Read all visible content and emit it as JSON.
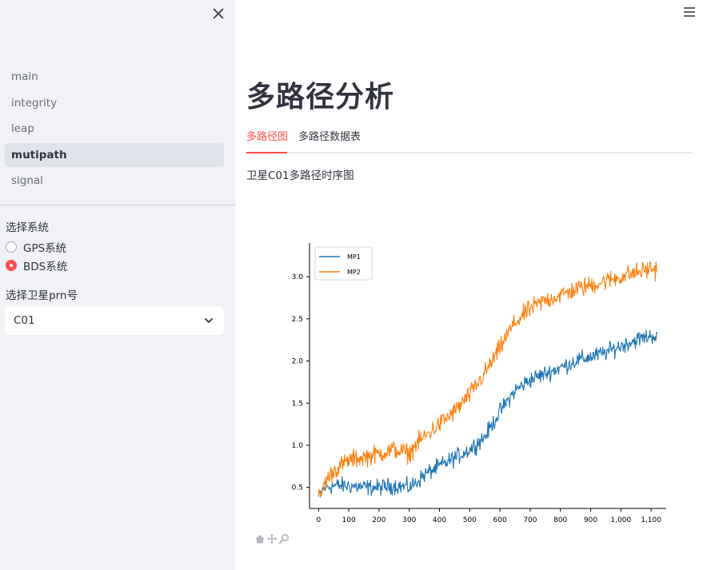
{
  "sidebar": {
    "close_label": "×",
    "nav": [
      "main",
      "integrity",
      "leap",
      "mutipath",
      "signal"
    ],
    "active_nav": "mutipath",
    "system_label": "选择系统",
    "system_options": [
      "GPS系统",
      "BDS系统"
    ],
    "system_selected": "BDS系统",
    "prn_label": "选择卫星prn号",
    "prn_value": "C01"
  },
  "main": {
    "title": "多路径分析",
    "tabs": [
      "多路径图",
      "多路径数据表"
    ],
    "active_tab": "多路径图",
    "caption": "卫星C01多路径时序图"
  },
  "toolbar": [
    "home-icon",
    "pan-icon",
    "zoom-icon"
  ],
  "colors": {
    "accent": "#ff4b4b",
    "mp1": "#1f77b4",
    "mp2": "#ff7f0e"
  },
  "chart_data": {
    "type": "line",
    "title": "",
    "xlabel": "",
    "ylabel": "",
    "xlim": [
      -30,
      1150
    ],
    "ylim": [
      0.25,
      3.4
    ],
    "xticks": [
      0,
      100,
      200,
      300,
      400,
      500,
      600,
      700,
      800,
      900,
      1000,
      1100
    ],
    "xtick_labels": [
      "0",
      "100",
      "200",
      "300",
      "400",
      "500",
      "600",
      "700",
      "800",
      "900",
      "1,000",
      "1,100"
    ],
    "yticks": [
      0.5,
      1.0,
      1.5,
      2.0,
      2.5,
      3.0
    ],
    "ytick_labels": [
      "0.5",
      "1.0",
      "1.5",
      "2.0",
      "2.5",
      "3.0"
    ],
    "legend_position": "top-left",
    "series": [
      {
        "name": "MP1",
        "color": "#1f77b4",
        "noise": 0.07,
        "x": [
          0,
          20,
          50,
          100,
          150,
          200,
          250,
          300,
          320,
          350,
          400,
          450,
          500,
          550,
          600,
          650,
          700,
          750,
          800,
          850,
          900,
          950,
          1000,
          1050,
          1100,
          1120
        ],
        "values": [
          0.38,
          0.5,
          0.52,
          0.52,
          0.5,
          0.5,
          0.52,
          0.5,
          0.55,
          0.65,
          0.75,
          0.85,
          0.95,
          1.1,
          1.4,
          1.65,
          1.78,
          1.85,
          1.92,
          2.0,
          2.05,
          2.1,
          2.18,
          2.25,
          2.3,
          2.3
        ]
      },
      {
        "name": "MP2",
        "color": "#ff7f0e",
        "noise": 0.08,
        "x": [
          0,
          20,
          50,
          100,
          150,
          200,
          250,
          300,
          320,
          350,
          400,
          450,
          500,
          550,
          600,
          630,
          650,
          700,
          750,
          800,
          850,
          900,
          950,
          1000,
          1050,
          1100,
          1120
        ],
        "values": [
          0.35,
          0.55,
          0.7,
          0.82,
          0.86,
          0.9,
          0.95,
          0.9,
          1.0,
          1.1,
          1.25,
          1.4,
          1.6,
          1.85,
          2.15,
          2.35,
          2.45,
          2.62,
          2.72,
          2.78,
          2.85,
          2.9,
          2.95,
          3.0,
          3.05,
          3.1,
          3.08
        ]
      }
    ]
  }
}
